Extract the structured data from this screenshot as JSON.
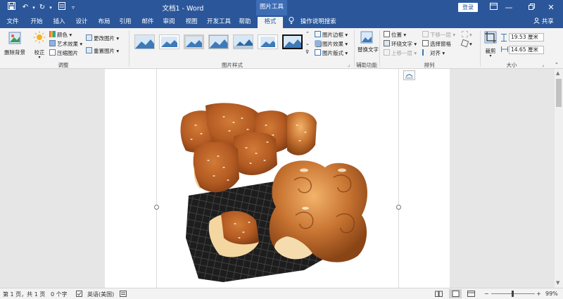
{
  "titlebar": {
    "doc_title": "文档1 - Word",
    "context_tab": "图片工具",
    "login_label": "登录"
  },
  "tabs": [
    "文件",
    "开始",
    "插入",
    "设计",
    "布局",
    "引用",
    "邮件",
    "审阅",
    "视图",
    "开发工具",
    "帮助",
    "格式"
  ],
  "active_tab": "格式",
  "tell_me": "操作说明搜索",
  "share": "共享",
  "ribbon": {
    "adjust": {
      "remove_bg": "删除背景",
      "corrections": "校正",
      "color": "颜色",
      "artistic": "艺术效果",
      "compress": "压缩图片",
      "change_pic": "更改图片",
      "reset_pic": "重置图片",
      "label": "调整"
    },
    "styles": {
      "label": "图片样式",
      "count": 7
    },
    "style_opts": {
      "border": "图片边框",
      "effects": "图片效果",
      "layout": "图片版式"
    },
    "accessibility": {
      "alt_text": "替换文字",
      "label": "辅助功能"
    },
    "arrange": {
      "position": "位置",
      "wrap": "环绕文字",
      "bring_forward": "上移一层",
      "send_backward": "下移一层",
      "selection_pane": "选择窗格",
      "align": "对齐",
      "label": "排列"
    },
    "size": {
      "crop": "裁剪",
      "height": "19.53 厘米",
      "width": "14.65 厘米",
      "label": "大小"
    }
  },
  "status": {
    "page": "第 1 页，共 1 页",
    "words": "0 个字",
    "language": "英语(美国)",
    "zoom": "99%"
  },
  "colors": {
    "brand": "#2b579a",
    "ribbon_bg": "#f3f3f3",
    "workspace": "#e6e6e6"
  }
}
